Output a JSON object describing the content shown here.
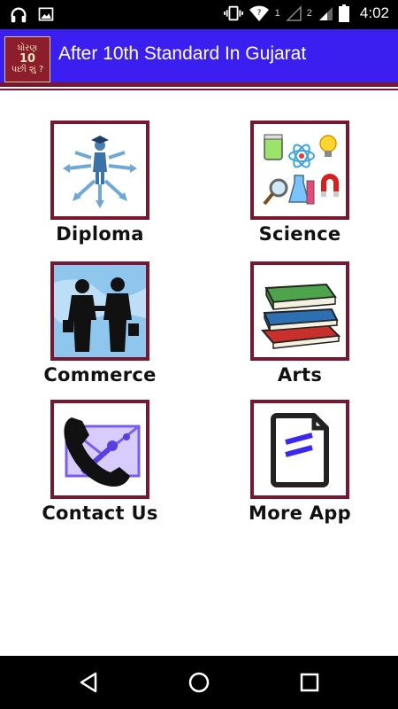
{
  "status_bar": {
    "left_icons": [
      "headphones-icon",
      "image-icon"
    ],
    "right_icons": [
      "vibrate-icon",
      "wifi-icon",
      "signal-icon",
      "signal-icon",
      "battery-icon"
    ],
    "sim1_label": "1",
    "sim2_label": "2",
    "time": "4:02"
  },
  "app_bar": {
    "title": "After 10th Standard In Gujarat",
    "logo_line1": "ધોરણ",
    "logo_line2": "10",
    "logo_line3": "પછી શું ?",
    "accent_color": "#3a1ff0",
    "border_color": "#7a1730"
  },
  "tiles": [
    {
      "label": "Diploma",
      "icon": "graduate-arrows-icon"
    },
    {
      "label": "Science",
      "icon": "science-lab-icon"
    },
    {
      "label": "Commerce",
      "icon": "business-handshake-icon"
    },
    {
      "label": "Arts",
      "icon": "stack-of-books-icon"
    },
    {
      "label": "Contact Us",
      "icon": "phone-icon"
    },
    {
      "label": "More App",
      "icon": "document-icon"
    }
  ],
  "nav_bar": {
    "buttons": [
      "back-icon",
      "home-icon",
      "recents-icon"
    ]
  }
}
